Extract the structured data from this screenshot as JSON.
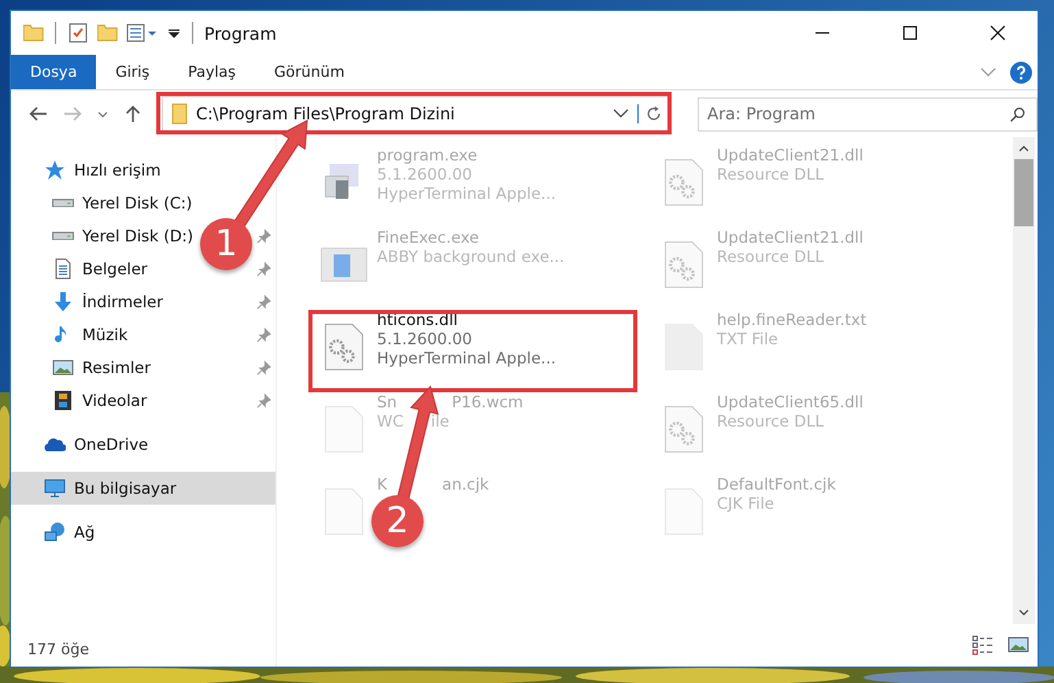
{
  "window": {
    "title": "Program"
  },
  "ribbon_tabs": [
    {
      "label": "Dosya",
      "selected": true
    },
    {
      "label": "Giriş",
      "selected": false
    },
    {
      "label": "Paylaş",
      "selected": false
    },
    {
      "label": "Görünüm",
      "selected": false
    }
  ],
  "address_bar": {
    "path": "C:\\Program Files\\Program Dizini"
  },
  "search": {
    "placeholder": "Ara: Program"
  },
  "sidebar": {
    "items": [
      {
        "label": "Hızlı erişim",
        "selected": false,
        "children": [
          {
            "label": "Yerel Disk (C:)",
            "selected": false,
            "pinned": false
          },
          {
            "label": "Yerel Disk (D:)",
            "selected": false,
            "pinned": true
          },
          {
            "label": "Belgeler",
            "selected": false,
            "pinned": true
          },
          {
            "label": "İndirmeler",
            "selected": false,
            "pinned": true
          },
          {
            "label": "Müzik",
            "selected": false,
            "pinned": true
          },
          {
            "label": "Resimler",
            "selected": false,
            "pinned": true
          },
          {
            "label": "Videolar",
            "selected": false,
            "pinned": true
          }
        ]
      },
      {
        "label": "OneDrive",
        "selected": false
      },
      {
        "label": "Bu bilgisayar",
        "selected": true
      },
      {
        "label": "Ağ",
        "selected": false
      }
    ]
  },
  "files": [
    {
      "kind": "app",
      "name": [
        "program.exe"
      ],
      "lines": [
        [
          "5.1.2600.00"
        ],
        [
          "HyperTerminal Apple..."
        ]
      ],
      "dimmed": true
    },
    {
      "kind": "window",
      "name": [
        "FineExec.exe"
      ],
      "lines": [
        [
          "ABBY background exe..."
        ]
      ],
      "dimmed": true
    },
    {
      "kind": "gear",
      "name": [
        "hticons.dll"
      ],
      "lines": [
        [
          "5.1.2600.00"
        ],
        [
          "HyperTerminal Apple..."
        ]
      ],
      "dimmed": false
    },
    {
      "kind": "blank",
      "name": [
        "Sn",
        "P16.wcm"
      ],
      "lines": [
        [
          "WC",
          "ile"
        ]
      ],
      "dimmed": true
    },
    {
      "kind": "blank",
      "name": [
        "K",
        "an.cjk"
      ],
      "dimmed": true
    },
    {
      "kind": "gear",
      "name": [
        "UpdateClient21.dll"
      ],
      "lines": [
        [
          "Resource DLL"
        ]
      ],
      "dimmed": true
    },
    {
      "kind": "gear",
      "name": [
        "UpdateClient21.dll"
      ],
      "lines": [
        [
          "Resource DLL"
        ]
      ],
      "dimmed": true
    },
    {
      "kind": "grey",
      "name": [
        "help.fineReader.txt"
      ],
      "lines": [
        [
          "TXT File"
        ]
      ],
      "dimmed": true
    },
    {
      "kind": "gear",
      "name": [
        "UpdateClient65.dll"
      ],
      "lines": [
        [
          "Resource DLL"
        ]
      ],
      "dimmed": true
    },
    {
      "kind": "blank",
      "name": [
        "DefaultFont.cjk"
      ],
      "lines": [
        [
          "CJK File"
        ]
      ],
      "dimmed": true
    }
  ],
  "status_bar": {
    "count": "177 öğe"
  },
  "annotations": [
    {
      "label": "1"
    },
    {
      "label": "2"
    }
  ]
}
